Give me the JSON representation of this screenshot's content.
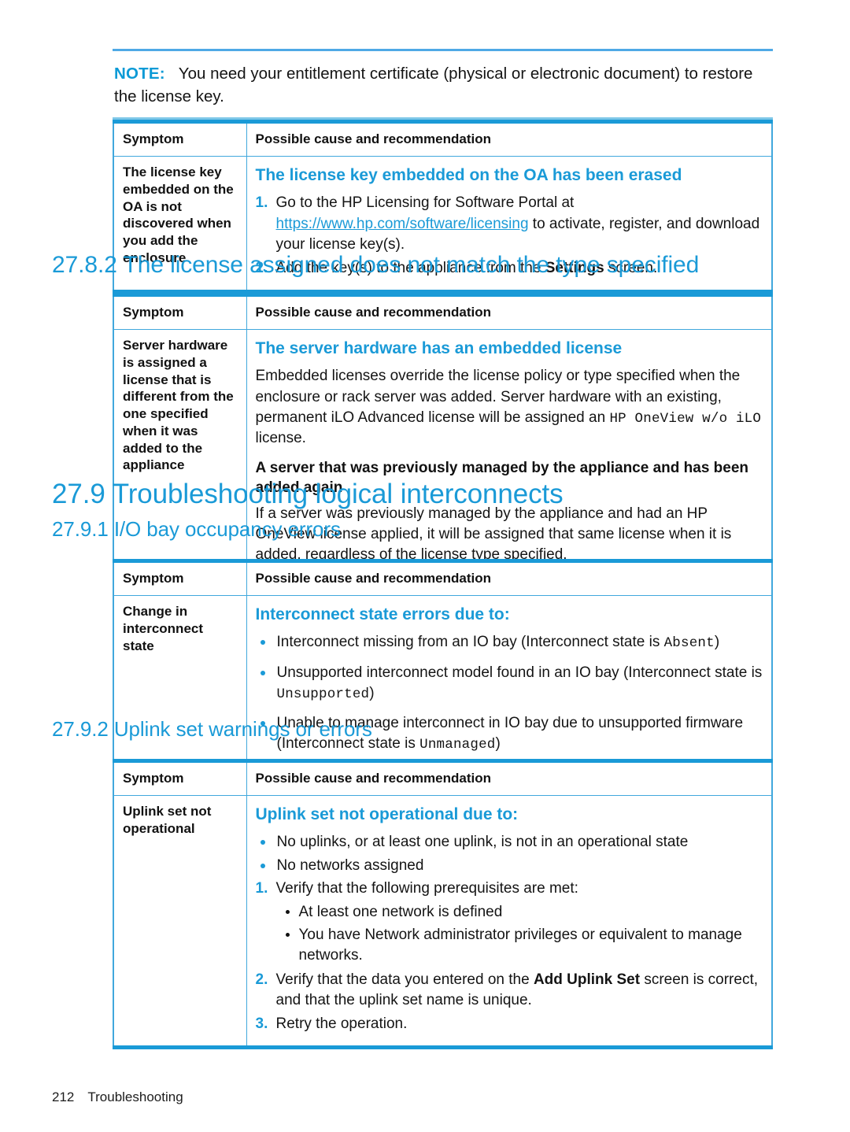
{
  "colors": {
    "accent": "#1a9ad7",
    "note_rule": "#4fa9e6",
    "text": "#141414"
  },
  "note": {
    "label": "NOTE:",
    "text": "You need your entitlement certificate (physical or electronic document) to restore the license key."
  },
  "table_headers": {
    "symptom": "Symptom",
    "cause": "Possible cause and recommendation"
  },
  "table1": {
    "symptom": "The license key embedded on the OA is not discovered when you add the enclosure",
    "blue_heading": "The license key embedded on the OA has been erased",
    "steps": [
      {
        "num": "1.",
        "pre": "Go to the HP Licensing for Software Portal at ",
        "link": "https://www.hp.com/software/licensing",
        "post": " to activate, register, and download your license key(s)."
      },
      {
        "num": "2.",
        "pre": "Add the key(s) to the appliance from the ",
        "bold": "Settings",
        "post": " screen."
      }
    ]
  },
  "section_2782": {
    "number": "27.8.2",
    "title": "The license assigned does not match the type specified"
  },
  "table2": {
    "symptom": "Server hardware is assigned a license that is different from the one specified when it was added to the appliance",
    "blue_heading": "The server hardware has an embedded license",
    "para1_pre": "Embedded licenses override the license policy or type specified when the enclosure or rack server was added. Server hardware with an existing, permanent iLO Advanced license will be assigned an ",
    "para1_mono": "HP OneView w/o iLO",
    "para1_post": " license.",
    "black_heading": "A server that was previously managed by the appliance and has been added again",
    "para2": "If a server was previously managed by the appliance and had an HP OneView license applied, it will be assigned that same license when it is added, regardless of the license type specified."
  },
  "section_279": {
    "number": "27.9",
    "title": "Troubleshooting logical interconnects"
  },
  "section_2791": {
    "number": "27.9.1",
    "title": "I/O bay occupancy errors"
  },
  "table3": {
    "symptom": "Change in interconnect state",
    "blue_heading": "Interconnect state errors due to:",
    "bullets": [
      {
        "pre": "Interconnect missing from an IO bay (Interconnect state is ",
        "mono": "Absent",
        "post": ")"
      },
      {
        "pre": "Unsupported interconnect model found in an IO bay (Interconnect state is ",
        "mono": "Unsupported",
        "post": ")"
      },
      {
        "pre": "Unable to manage interconnect in IO bay due to unsupported firmware (Interconnect state is ",
        "mono": "Unmanaged",
        "post": ")"
      }
    ]
  },
  "section_2792": {
    "number": "27.9.2",
    "title": "Uplink set warnings or errors"
  },
  "table4": {
    "symptom": "Uplink set not operational",
    "blue_heading": "Uplink set not operational due to:",
    "bullets": [
      "No uplinks, or at least one uplink, is not in an operational state",
      "No networks assigned"
    ],
    "steps": [
      {
        "num": "1.",
        "text": "Verify that the following prerequisites are met:"
      },
      {
        "num": "2.",
        "pre": "Verify that the data you entered on the ",
        "bold": "Add Uplink Set",
        "post": " screen is correct, and that the uplink set name is unique."
      },
      {
        "num": "3.",
        "text": "Retry the operation."
      }
    ],
    "substeps": [
      "At least one network is defined",
      "You have Network administrator privileges or equivalent to manage networks."
    ]
  },
  "footer": {
    "page_number": "212",
    "chapter": "Troubleshooting"
  }
}
